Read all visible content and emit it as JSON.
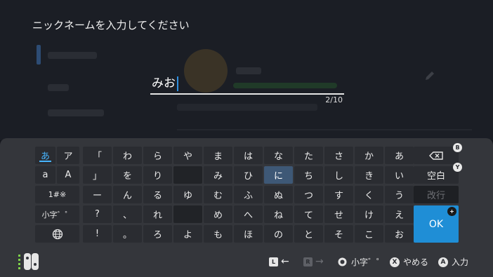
{
  "prompt": "ニックネームを入力してください",
  "input": {
    "value": "みお",
    "counter": "2/10"
  },
  "mode_keys": {
    "hiragana": "あ",
    "katakana": "ア",
    "latin_lower": "a",
    "latin_upper": "A",
    "symbols": "1#※",
    "small": "小字゛゜",
    "globe": "globe"
  },
  "kana": {
    "row1": [
      "「",
      "わ",
      "ら",
      "や",
      "ま",
      "は",
      "な",
      "た",
      "さ",
      "か",
      "あ"
    ],
    "row2": [
      "」",
      "を",
      "り",
      "",
      "み",
      "ひ",
      "に",
      "ち",
      "し",
      "き",
      "い"
    ],
    "row3": [
      "ー",
      "ん",
      "る",
      "ゆ",
      "む",
      "ふ",
      "ぬ",
      "つ",
      "す",
      "く",
      "う"
    ],
    "row4": [
      "?",
      "、",
      "れ",
      "",
      "め",
      "へ",
      "ね",
      "て",
      "せ",
      "け",
      "え"
    ],
    "row5": [
      "!",
      "。",
      "ろ",
      "よ",
      "も",
      "ほ",
      "の",
      "と",
      "そ",
      "こ",
      "お"
    ]
  },
  "selected_key": "に",
  "actions": {
    "space": "空白",
    "newline": "改行",
    "ok": "OK"
  },
  "badges": {
    "backspace": "B",
    "space": "Y",
    "ok": "+"
  },
  "footer": {
    "l_btn": "L",
    "r_btn": "R",
    "small_label": "小字゛゜",
    "x_btn": "X",
    "cancel": "やめる",
    "a_btn": "A",
    "enter": "入力"
  },
  "colors": {
    "accent": "#1f8ed6",
    "selected": "#3e5876",
    "caret": "#2f8fe0",
    "mode_active": "#47b5ff"
  }
}
